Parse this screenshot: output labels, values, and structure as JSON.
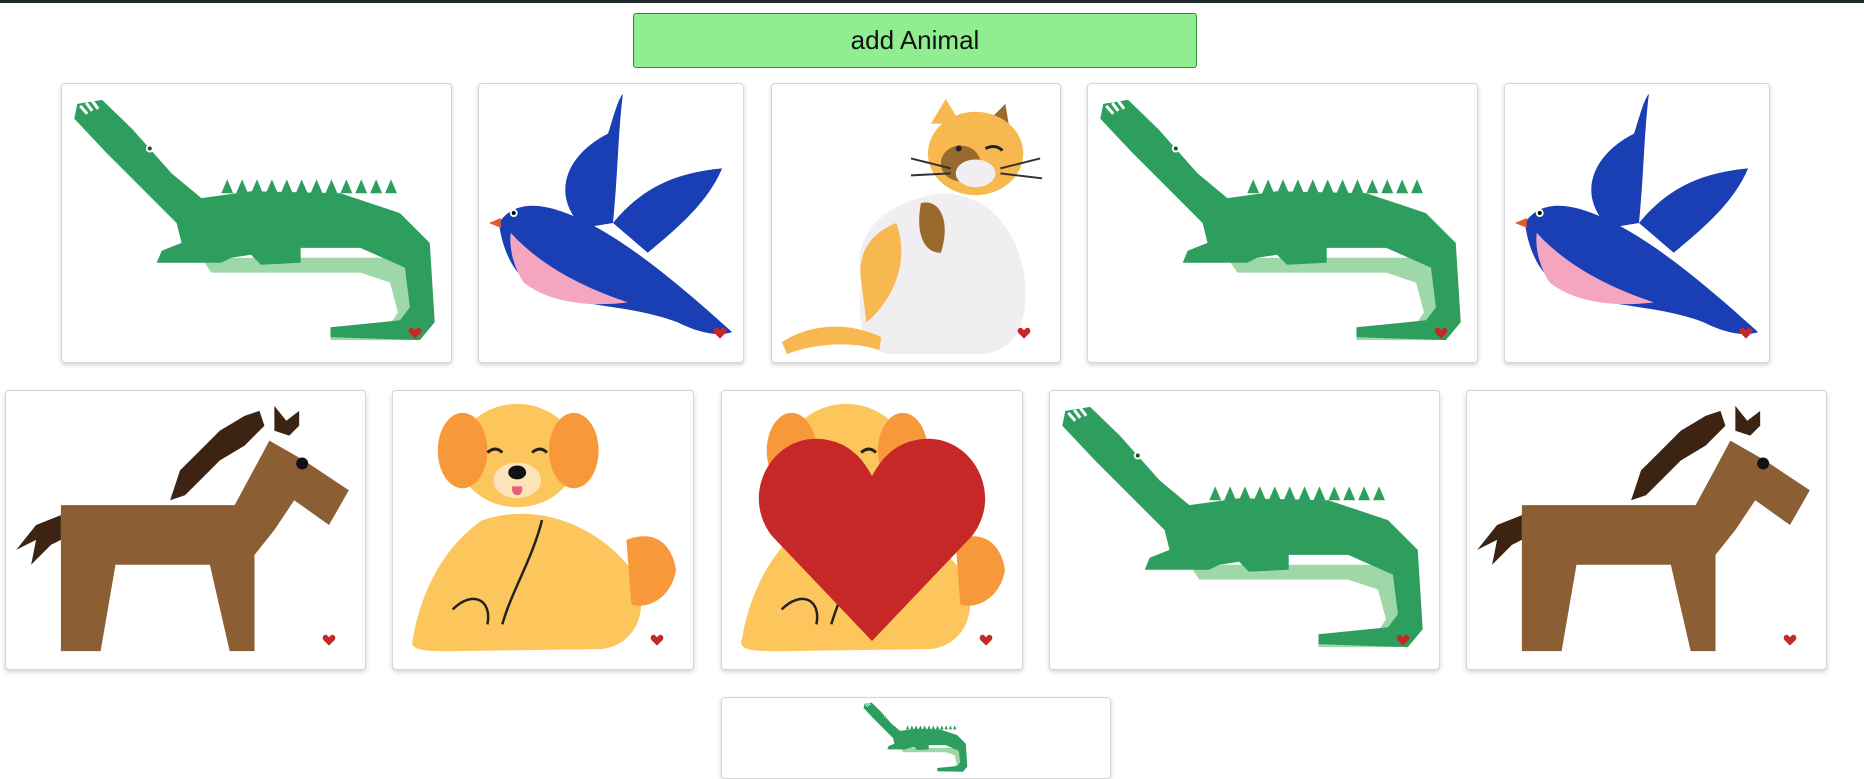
{
  "add_button": {
    "label": "add Animal"
  },
  "colors": {
    "button_bg": "#90ee90",
    "heart": "#c62828",
    "croc_green": "#2e9e5e",
    "croc_light": "#9fd8a8",
    "bird_blue": "#1a3fb5",
    "bird_pink": "#f4a6c1",
    "horse_brown": "#8b5e34",
    "horse_mane": "#3d2412",
    "dog_yellow": "#fcc65c",
    "dog_orange": "#f7993a",
    "cat_white": "#f0eef0",
    "cat_orange": "#f6b84f"
  },
  "cards": [
    {
      "animal": "crocodile",
      "liked": false
    },
    {
      "animal": "bird",
      "liked": false
    },
    {
      "animal": "cat",
      "liked": false
    },
    {
      "animal": "crocodile",
      "liked": false
    },
    {
      "animal": "bird",
      "liked": false
    },
    {
      "animal": "horse",
      "liked": false
    },
    {
      "animal": "dog",
      "liked": false
    },
    {
      "animal": "dog",
      "liked": true
    },
    {
      "animal": "crocodile",
      "liked": false
    },
    {
      "animal": "horse",
      "liked": false
    },
    {
      "animal": "crocodile",
      "liked": false
    }
  ]
}
